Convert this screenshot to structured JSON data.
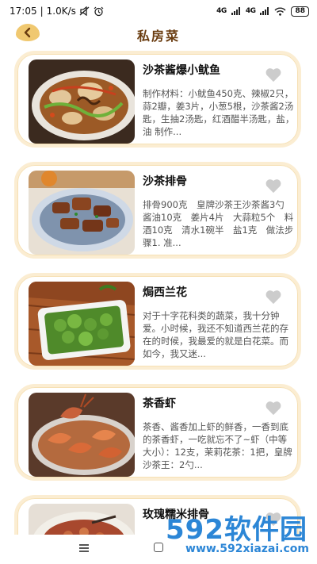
{
  "status_bar": {
    "time": "17:05",
    "speed": "1.0K/s",
    "signal_1": "4G",
    "signal_2": "4G",
    "battery": "88"
  },
  "app_bar": {
    "title": "私房菜",
    "back_icon": "back-arrow-icon"
  },
  "recipes": [
    {
      "title": "沙茶酱爆小鱿鱼",
      "description": "制作材料：小鱿鱼450克、辣椒2只，蒜2瓣，姜3片，小葱5根，沙茶酱2汤匙，生抽2汤匙，红酒醋半汤匙，盐，油 制作...",
      "favorite_icon": "heart-icon"
    },
    {
      "title": "沙茶排骨",
      "description": "排骨900克　皇牌沙茶王沙茶酱3勺　酱油10克　姜片4片　大蒜粒5个　料酒10克　清水1碗半　盐1克　做法步骤1. 准...",
      "favorite_icon": "heart-icon"
    },
    {
      "title": "焗西兰花",
      "description": "对于十字花科类的蔬菜，我十分钟爱。小时候，我还不知道西兰花的存在的时候，我最爱的就是白花菜。而如今，我又迷...",
      "favorite_icon": "heart-icon"
    },
    {
      "title": "茶香虾",
      "description": "茶香、酱香加上虾的鲜香，一香到底的茶香虾，一吃就忘不了~虾（中等大小）：12支，茉莉花茶：1把，皇牌沙茶王：2勺...",
      "favorite_icon": "heart-icon"
    },
    {
      "title": "玫瑰糯米排骨",
      "description": "",
      "favorite_icon": "heart-icon"
    }
  ],
  "watermark": {
    "brand_num": "592",
    "brand_text": "软件园",
    "url": "www.592xiazai.com"
  },
  "colors": {
    "card_border": "#fbedd2",
    "title_brown": "#6a3c10",
    "back_button": "#f0c870",
    "heart_gray": "#cccccc"
  }
}
